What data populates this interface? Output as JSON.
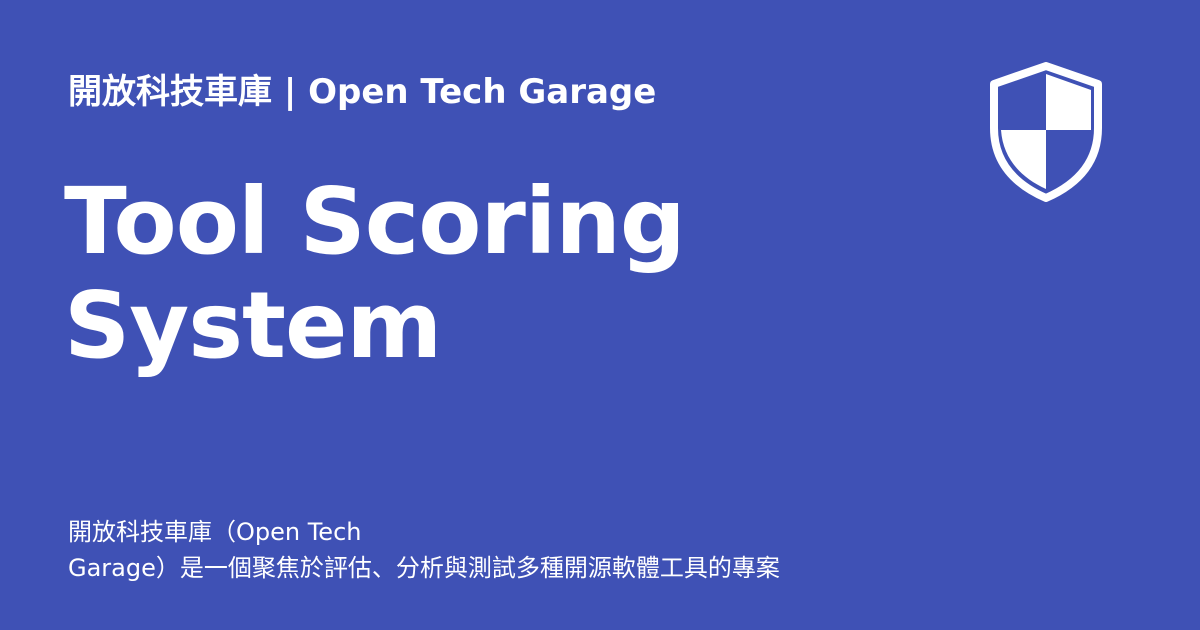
{
  "header": {
    "brand_line": "開放科技車庫 | Open Tech Garage"
  },
  "main": {
    "title_line1": "Tool Scoring",
    "title_line2": "System",
    "description_line1": "開放科技車庫（Open Tech",
    "description_line2": "Garage）是一個聚焦於評估、分析與測試多種開源軟體工具的專案"
  },
  "icon": {
    "name": "shield-icon"
  },
  "colors": {
    "background": "#3f51b5",
    "text": "#ffffff"
  }
}
